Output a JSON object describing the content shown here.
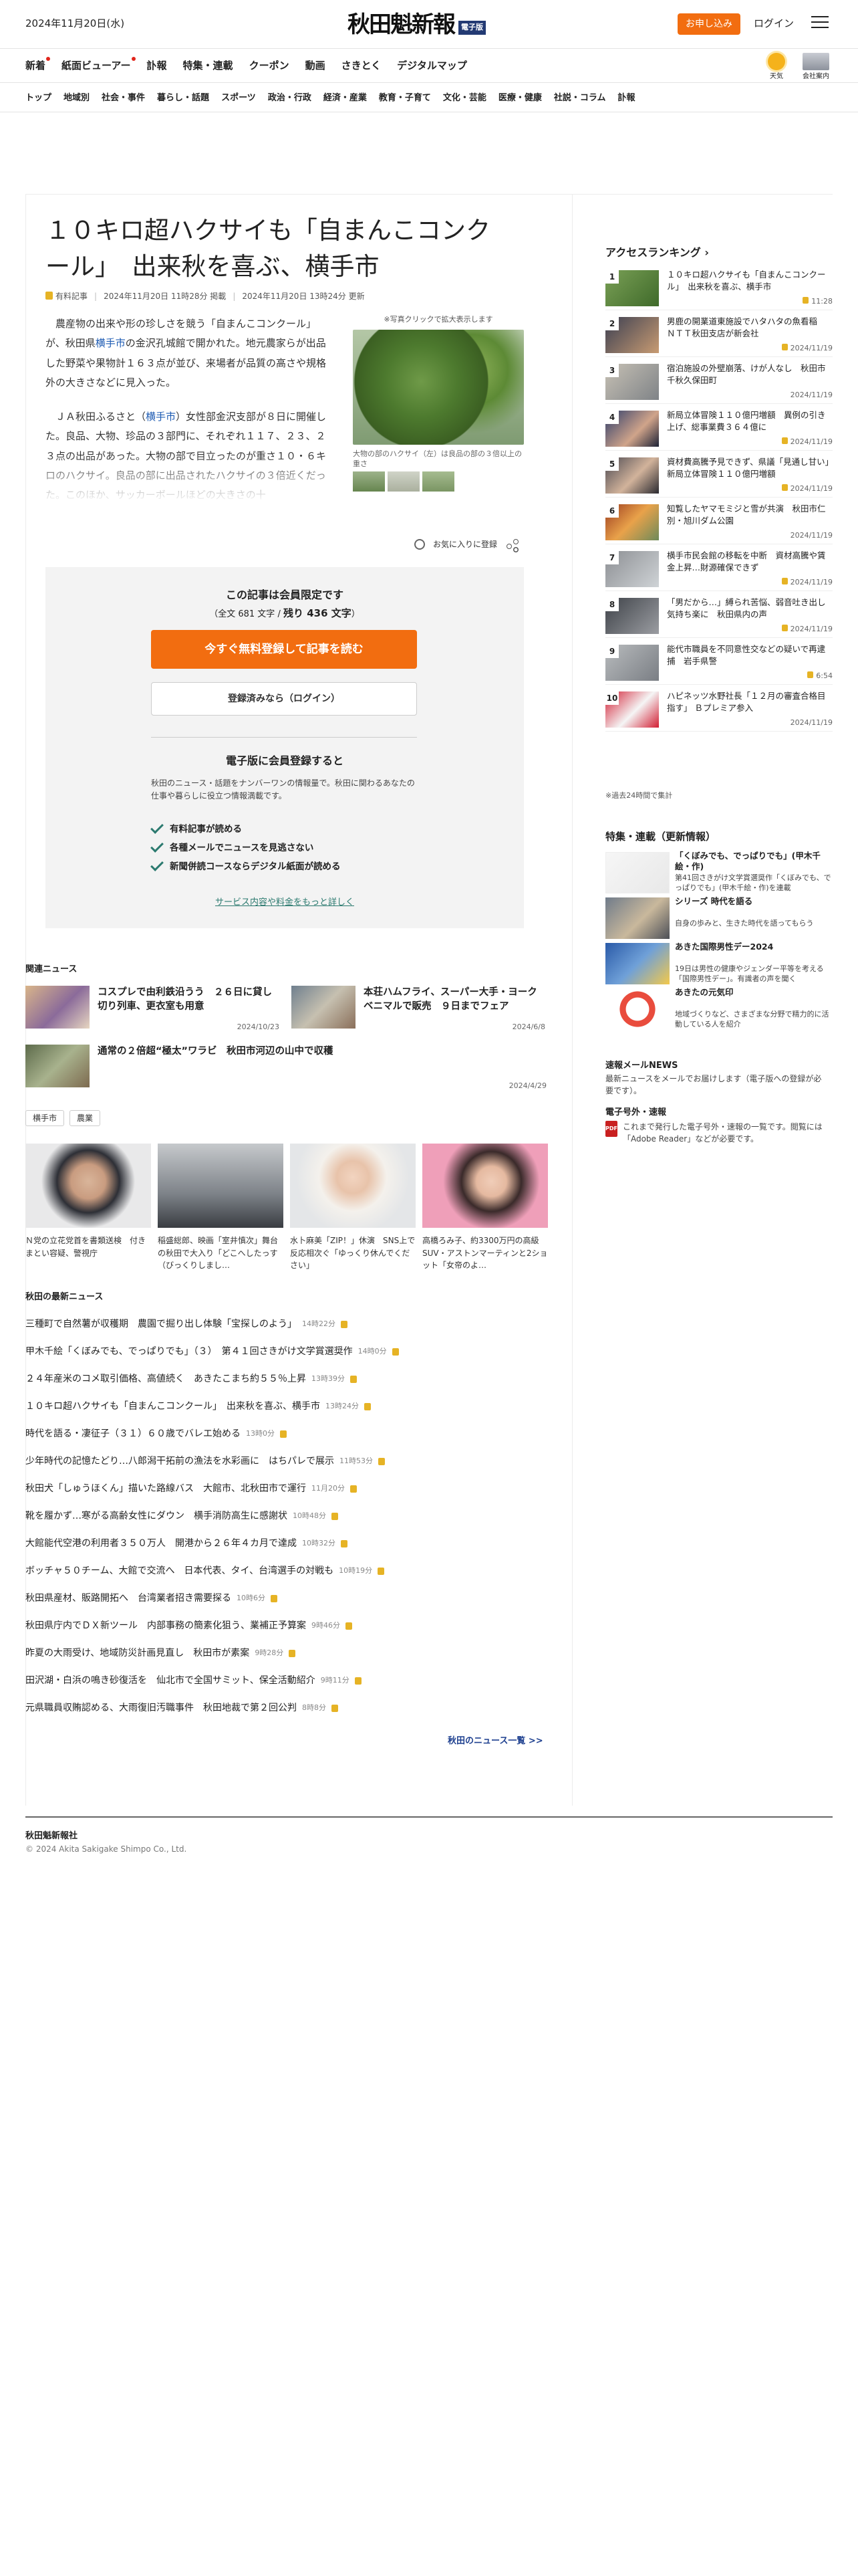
{
  "header": {
    "date": "2024年11月20日(水)",
    "logo": "秋田魁新報",
    "logo_badge": "電子版",
    "apply": "お申し込み",
    "login": "ログイン"
  },
  "nav_main": [
    "新着",
    "紙面ビューアー",
    "訃報",
    "特集・連載",
    "クーポン",
    "動画",
    "さきとく",
    "デジタルマップ"
  ],
  "nav_weather": "天気",
  "nav_company": "会社案内",
  "nav_sub": [
    "トップ",
    "地域別",
    "社会・事件",
    "暮らし・話題",
    "スポーツ",
    "政治・行政",
    "経済・産業",
    "教育・子育て",
    "文化・芸能",
    "医療・健康",
    "社説・コラム",
    "訃報"
  ],
  "article": {
    "title": "１０キロ超ハクサイも「自まんこコンクール」　出来秋を喜ぶ、横手市",
    "paid": "有料記事",
    "published": "2024年11月20日 11時28分 掲載",
    "updated": "2024年11月20日 13時24分 更新",
    "p1_a": "　農産物の出来や形の珍しさを競う「自まんこコンクール」が、秋田県",
    "p1_link": "横手市",
    "p1_b": "の金沢孔城館で開かれた。地元農家らが出品した野菜や果物計１６３点が並び、来場者が品質の高さや規格外の大きさなどに見入った。",
    "p2_a": "　ＪＡ秋田ふるさと（",
    "p2_link": "横手市",
    "p2_b": "）女性部金沢支部が８日に開催した。良品、大物、珍品の３部門に、それぞれ１１７、２３、２３点の出品があった。大物の部で目立ったのが重さ１０・６キロのハクサイ。良品の部に出品されたハクサイの３倍近くだった。このほか、サッカーボールほどの大きさの十",
    "photo_hint": "※写真クリックで拡大表示します",
    "photo_caption": "大物の部のハクサイ（左）は良品の部の３倍以上の重さ",
    "favorite": "お気に入りに登録"
  },
  "member": {
    "title": "この記事は会員限定です",
    "count_pre": "（全文 681 文字 / ",
    "count_rest": "残り 436 文字",
    "count_post": "）",
    "register": "今すぐ無料登録して記事を読む",
    "login": "登録済みなら（ログイン）",
    "benefit_title": "電子版に会員登録すると",
    "benefit_desc": "秋田のニュース・話題をナンバーワンの情報量で。秋田に関わるあなたの仕事や暮らしに役立つ情報満載です。",
    "benefits": [
      "有料記事が読める",
      "各種メールでニュースを見逃さない",
      "新聞併読コースならデジタル紙面が読める"
    ],
    "more": "サービス内容や料金をもっと詳しく"
  },
  "related": {
    "title": "関連ニュース",
    "items": [
      {
        "title": "コスプレで由利鉄沿うう　２６日に貸し切り列車、更衣室も用意",
        "date": "2024/10/23"
      },
      {
        "title": "本荘ハムフライ、スーパー大手・ヨークベニマルで販売　９日までフェア",
        "date": "2024/6/8"
      },
      {
        "title": "通常の２倍超“極太”ワラビ　秋田市河辺の山中で収穫",
        "date": "2024/4/29"
      }
    ]
  },
  "tags": [
    "横手市",
    "農業"
  ],
  "photo_news": [
    {
      "title": "Ｎ党の立花党首を書類送検　付きまとい容疑、警視庁"
    },
    {
      "title": "稲盛総郎、映画「室井慎次」舞台の秋田で大入り「どこへしたっす（びっくりしまし…"
    },
    {
      "title": "水卜麻美「ZIP！」休演　SNS上で反応相次ぐ「ゆっくり休んでください」"
    },
    {
      "title": "高橋ろみ子、約3300万円の高級SUV・アストンマーティンと2ショット「女帝のよ…"
    }
  ],
  "latest": {
    "title": "秋田の最新ニュース",
    "items": [
      {
        "title": "三種町で自然薯が収穫期　農園で掘り出し体験「宝探しのよう」",
        "time": "14時22分"
      },
      {
        "title": "甲木千絵「くぼみでも、でっぱりでも」（３）　第４１回さきがけ文学賞選奨作",
        "time": "14時0分"
      },
      {
        "title": "２４年産米のコメ取引価格、高値続く　あきたこまち約５５％上昇",
        "time": "13時39分"
      },
      {
        "title": "１０キロ超ハクサイも「自まんこコンクール」　出来秋を喜ぶ、横手市",
        "time": "13時24分"
      },
      {
        "title": "時代を語る・凄征子（３１）６０歳でバレエ始める",
        "time": "13時0分"
      },
      {
        "title": "少年時代の記憶たどり…八郎潟干拓前の漁法を水彩画に　はちパレで展示",
        "time": "11時53分"
      },
      {
        "title": "秋田犬「しゅうほくん」描いた路線バス　大館市、北秋田市で運行",
        "time": "11月20分"
      },
      {
        "title": "靴を履かず…寒がる高齢女性にダウン　横手消防高生に感謝状",
        "time": "10時48分"
      },
      {
        "title": "大館能代空港の利用者３５０万人　開港から２６年４カ月で達成",
        "time": "10時32分"
      },
      {
        "title": "ボッチャ５０チーム、大館で交流へ　日本代表、タイ、台湾選手の対戦も",
        "time": "10時19分"
      },
      {
        "title": "秋田県産材、販路開拓へ　台湾業者招き需要探る",
        "time": "10時6分"
      },
      {
        "title": "秋田県庁内でＤＸ新ツール　内部事務の簡素化狙う、業補正予算案",
        "time": "9時46分"
      },
      {
        "title": "昨夏の大雨受け、地域防災計画見直し　秋田市が素案",
        "time": "9時28分"
      },
      {
        "title": "田沢湖・白浜の鳴き砂復活を　仙北市で全国サミット、保全活動紹介",
        "time": "9時11分"
      },
      {
        "title": "元県職員収賄認める、大雨復旧汚職事件　秋田地裁で第２回公判",
        "time": "8時8分"
      }
    ],
    "more": "秋田のニュース一覧 >>"
  },
  "ranking": {
    "title": "アクセスランキング",
    "items": [
      {
        "title": "１０キロ超ハクサイも「自まんこコンクール」　出来秋を喜ぶ、横手市",
        "date": "11:28",
        "locked": true
      },
      {
        "title": "男鹿の開業道東施設でハタハタの魚看稲　ＮＴＴ秋田支店が新会社",
        "date": "2024/11/19",
        "locked": true
      },
      {
        "title": "宿泊施設の外壁崩落、けが人なし　秋田市千秋久保田町",
        "date": "2024/11/19",
        "locked": false
      },
      {
        "title": "新局立体冒険１１０億円増額　異例の引き上げ、総事業費３６４億に",
        "date": "2024/11/19",
        "locked": true
      },
      {
        "title": "資材費高騰予見できず、県議「見通し甘い」新局立体冒険１１０億円増額",
        "date": "2024/11/19",
        "locked": true
      },
      {
        "title": "知覧したヤマモミジと雪が共演　秋田市仁別・旭川ダム公園",
        "date": "2024/11/19",
        "locked": false
      },
      {
        "title": "横手市民会館の移転を中断　資材高騰や賃金上昇…財源確保できず",
        "date": "2024/11/19",
        "locked": true
      },
      {
        "title": "「男だから…」縛られ苦悩、弱音吐き出し気持ち楽に　秋田県内の声",
        "date": "2024/11/19",
        "locked": true
      },
      {
        "title": "能代市職員を不同意性交などの疑いで再逮捕　岩手県警",
        "date": "6:54",
        "locked": true
      },
      {
        "title": "ハピネッツ水野社長「１２月の審査合格目指す」 Ｂプレミア参入",
        "date": "2024/11/19",
        "locked": false
      }
    ],
    "note": "※過去24時間で集計"
  },
  "features": {
    "title": "特集・連載（更新情報）",
    "items": [
      {
        "title": "「くぼみでも、でっぱりでも」(甲木千絵・作)",
        "sub": "第41回さきがけ文学賞選奨作「くぼみでも、でっぱりでも」(甲木千絵・作)を連載"
      },
      {
        "title": "シリーズ 時代を語る",
        "sub": "自身の歩みと、生きた時代を語ってもらう"
      },
      {
        "title": "あきた国際男性デー2024",
        "sub": "19日は男性の健康やジェンダー平等を考える「国際男性デー」。有識者の声を聞く"
      },
      {
        "title": "あきたの元気印",
        "sub": "地域づくりなど、さまざまな分野で精力的に活動している人を紹介"
      }
    ]
  },
  "mail": {
    "title": "速報メールNEWS",
    "desc": "最新ニュースをメールでお届けします（電子版への登録が必要です）。"
  },
  "extra": {
    "title": "電子号外・速報",
    "desc": "これまで発行した電子号外・速報の一覧です。閲覧には「Adobe Reader」などが必要です。"
  },
  "footer": {
    "name": "秋田魁新報社",
    "copy": "© 2024 Akita Sakigake Shimpo Co., Ltd."
  }
}
